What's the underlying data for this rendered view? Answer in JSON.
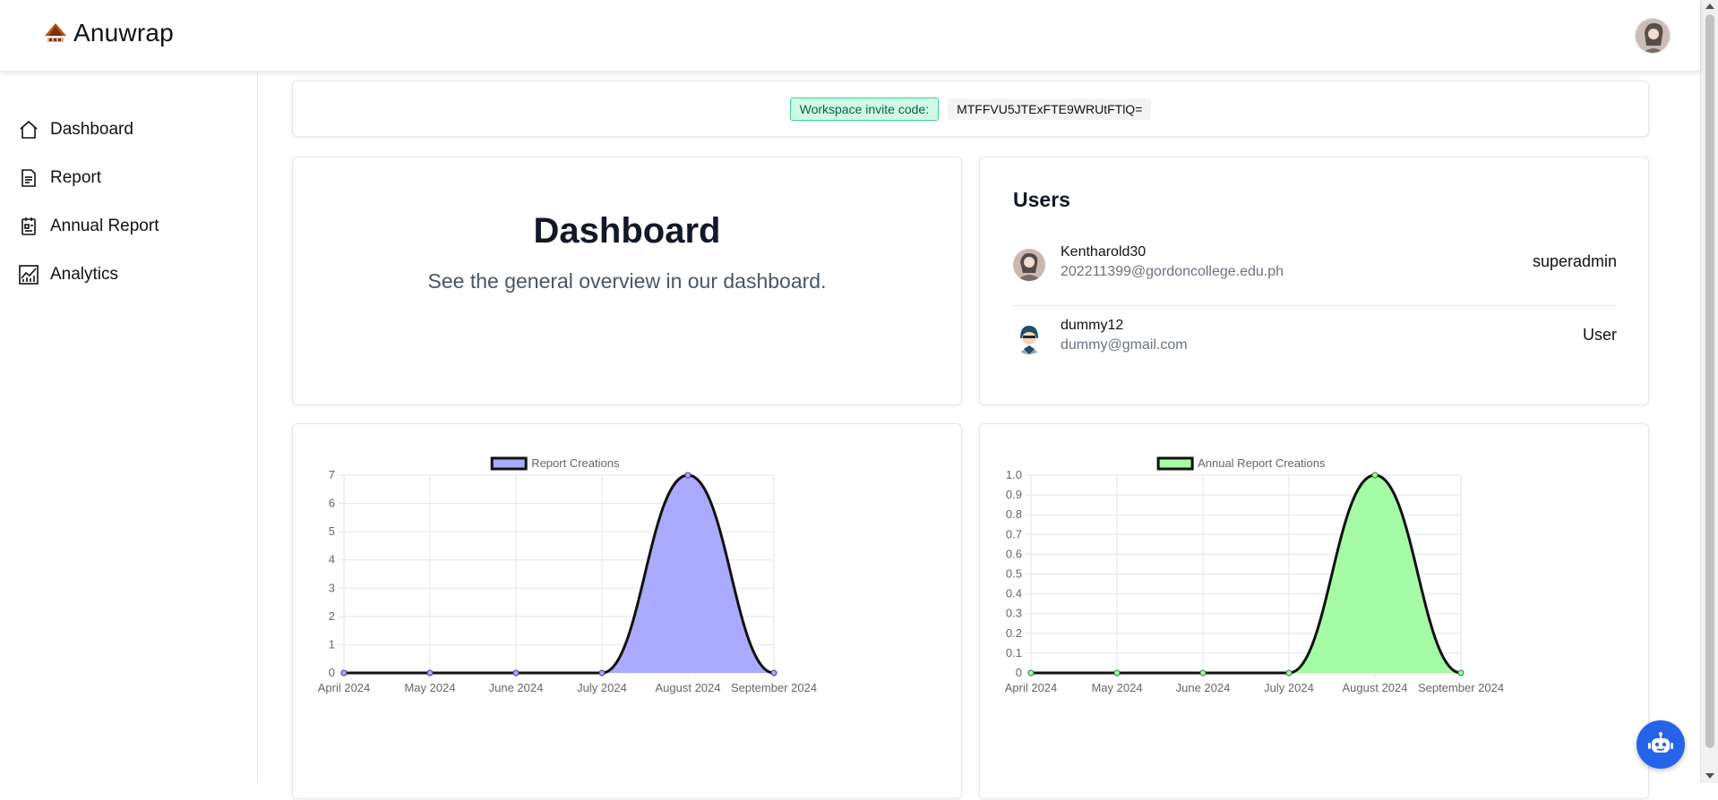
{
  "header": {
    "brand_name": "Anuwrap",
    "brand_logo_icon": "house-logo-icon",
    "avatar_icon": "user-avatar-icon"
  },
  "sidebar": {
    "items": [
      {
        "label": "Dashboard",
        "icon": "home-icon"
      },
      {
        "label": "Report",
        "icon": "document-icon"
      },
      {
        "label": "Annual Report",
        "icon": "calendar-report-icon"
      },
      {
        "label": "Analytics",
        "icon": "chart-icon"
      }
    ]
  },
  "invite": {
    "label": "Workspace invite code:",
    "code": "MTFFVU5JTExFTE9WRUtFTlQ="
  },
  "dashboard": {
    "title": "Dashboard",
    "subtitle": "See the general overview in our dashboard."
  },
  "users": {
    "title": "Users",
    "list": [
      {
        "name": "Kentharold30",
        "email": "202211399@gordoncollege.edu.ph",
        "role": "superadmin"
      },
      {
        "name": "dummy12",
        "email": "dummy@gmail.com",
        "role": "User"
      }
    ]
  },
  "colors": {
    "accent_blue": "#2563eb",
    "report_fill": "#aaaaff",
    "annual_fill": "#a5fba5",
    "line": "#111111",
    "invite_bg": "#d1fae5"
  },
  "chart_data": [
    {
      "type": "area",
      "series": [
        {
          "name": "Report Creations",
          "values": [
            0,
            0,
            0,
            0,
            7,
            0
          ]
        }
      ],
      "x": [
        "April 2024",
        "May 2024",
        "June 2024",
        "July 2024",
        "August 2024",
        "September 2024"
      ],
      "ylim": [
        0,
        7
      ],
      "yticks": [
        "0",
        "1",
        "2",
        "3",
        "4",
        "5",
        "6",
        "7"
      ],
      "legend": "top-center",
      "grid": true
    },
    {
      "type": "area",
      "series": [
        {
          "name": "Annual Report Creations",
          "values": [
            0,
            0,
            0,
            0,
            1,
            0
          ]
        }
      ],
      "x": [
        "April 2024",
        "May 2024",
        "June 2024",
        "July 2024",
        "August 2024",
        "September 2024"
      ],
      "ylim": [
        0,
        1
      ],
      "yticks": [
        "0",
        "0.1",
        "0.2",
        "0.3",
        "0.4",
        "0.5",
        "0.6",
        "0.7",
        "0.8",
        "0.9",
        "1.0"
      ],
      "legend": "top-center",
      "grid": true
    }
  ]
}
